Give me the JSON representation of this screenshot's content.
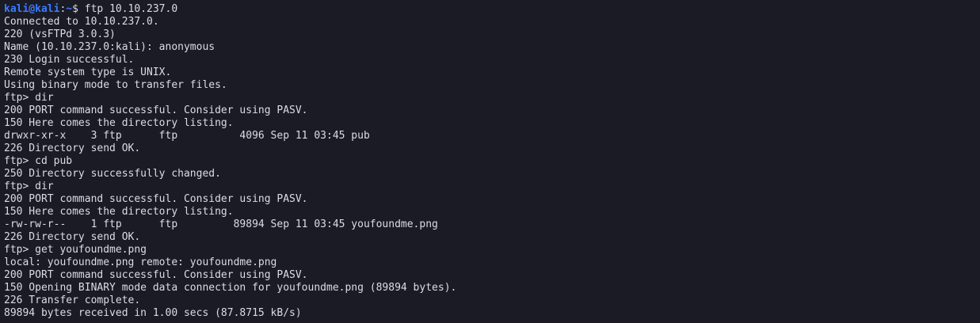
{
  "colors": {
    "background": "#1a1b25",
    "foreground": "#dcdde3",
    "prompt": "#3d7bff"
  },
  "prompt": {
    "user_host": "kali@kali",
    "separator": ":",
    "path": "~",
    "symbol": "$ ",
    "command": "ftp 10.10.237.0"
  },
  "lines": [
    "Connected to 10.10.237.0.",
    "220 (vsFTPd 3.0.3)",
    "Name (10.10.237.0:kali): anonymous",
    "230 Login successful.",
    "Remote system type is UNIX.",
    "Using binary mode to transfer files.",
    "ftp> dir",
    "200 PORT command successful. Consider using PASV.",
    "150 Here comes the directory listing.",
    "drwxr-xr-x    3 ftp      ftp          4096 Sep 11 03:45 pub",
    "226 Directory send OK.",
    "ftp> cd pub",
    "250 Directory successfully changed.",
    "ftp> dir",
    "200 PORT command successful. Consider using PASV.",
    "150 Here comes the directory listing.",
    "-rw-rw-r--    1 ftp      ftp         89894 Sep 11 03:45 youfoundme.png",
    "226 Directory send OK.",
    "ftp> get youfoundme.png",
    "local: youfoundme.png remote: youfoundme.png",
    "200 PORT command successful. Consider using PASV.",
    "150 Opening BINARY mode data connection for youfoundme.png (89894 bytes).",
    "226 Transfer complete.",
    "89894 bytes received in 1.00 secs (87.8715 kB/s)"
  ]
}
